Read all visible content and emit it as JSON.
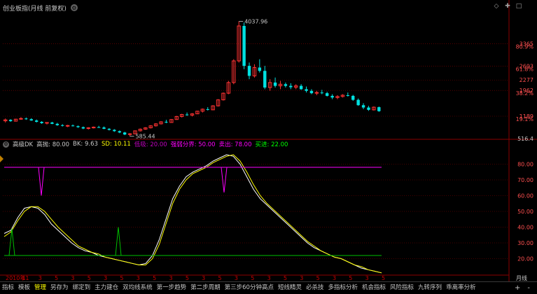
{
  "header": {
    "title": "创业板指(月线 前复权)",
    "controls": [
      "◇",
      "✚",
      "□"
    ]
  },
  "price_chart": {
    "axis_labels": [
      {
        "text": "3365",
        "value": 3365,
        "color": "#ff5050"
      },
      {
        "text": "80.9%",
        "value": 3280,
        "color": "#ff5050"
      },
      {
        "text": "2693",
        "value": 2693,
        "color": "#ff5050"
      },
      {
        "text": "61.8%",
        "value": 2610,
        "color": "#ff5050"
      },
      {
        "text": "2277",
        "value": 2277,
        "color": "#ff5050"
      },
      {
        "text": "1962",
        "value": 1962,
        "color": "#ff5050"
      },
      {
        "text": "38.2%",
        "value": 1880,
        "color": "#ff5050"
      },
      {
        "text": "1189",
        "value": 1189,
        "color": "#ff5050"
      },
      {
        "text": "19.1%",
        "value": 1110,
        "color": "#ff5050"
      },
      {
        "text": "516.4",
        "value": 516.4,
        "color": "#c8c8c8"
      }
    ],
    "high_label": "4037.96",
    "low_label": "585.44",
    "high_value": 4037.96,
    "low_value": 585.44,
    "colors": {
      "up": "#ff3232",
      "down": "#00e0e0",
      "grid": "#8b0000"
    }
  },
  "indicator": {
    "name": "高级DK",
    "params": [
      {
        "label": "高抛: 80.00",
        "color": "#c8c8c8"
      },
      {
        "label": "BK: 9.63",
        "color": "#c8c8c8"
      },
      {
        "label": "SD: 10.11",
        "color": "#ffff00"
      },
      {
        "label": "低吸: 20.00",
        "color": "#c000c0"
      },
      {
        "label": "强弱分界: 50.00",
        "color": "#ff00ff"
      },
      {
        "label": "卖出: 78.00",
        "color": "#ff00ff"
      },
      {
        "label": "买进: 22.00",
        "color": "#00ff00"
      }
    ],
    "axis_labels": [
      "80.00",
      "70.00",
      "60.00",
      "50.00",
      "40.00",
      "30.00",
      "20.00"
    ],
    "axis_values": [
      80,
      70,
      60,
      50,
      40,
      30,
      20
    ]
  },
  "time_axis": {
    "labels": [
      "2010年",
      "11",
      "3",
      "5",
      "3",
      "5",
      "3",
      "5",
      "3",
      "5",
      "3",
      "5",
      "3",
      "5",
      "3",
      "5",
      "3",
      "5",
      "3",
      "5",
      "3",
      "5",
      "3",
      "5"
    ],
    "period_label": "月线"
  },
  "chart_data": [
    {
      "type": "candlestick",
      "title": "创业板指(月线 前复权)",
      "series": [
        {
          "name": "monthly",
          "ohlc": [
            [
              1050,
              1120,
              1000,
              1080
            ],
            [
              1080,
              1100,
              1020,
              1040
            ],
            [
              1040,
              1110,
              1030,
              1100
            ],
            [
              1100,
              1160,
              1080,
              1120
            ],
            [
              1120,
              1150,
              1080,
              1100
            ],
            [
              1100,
              1130,
              1050,
              1060
            ],
            [
              1060,
              1090,
              1000,
              1020
            ],
            [
              1020,
              1040,
              960,
              980
            ],
            [
              980,
              1010,
              940,
              1000
            ],
            [
              1000,
              1020,
              950,
              960
            ],
            [
              960,
              990,
              900,
              920
            ],
            [
              920,
              950,
              880,
              900
            ],
            [
              900,
              930,
              860,
              910
            ],
            [
              910,
              940,
              880,
              890
            ],
            [
              890,
              910,
              840,
              860
            ],
            [
              860,
              880,
              800,
              820
            ],
            [
              820,
              860,
              790,
              840
            ],
            [
              840,
              880,
              820,
              860
            ],
            [
              860,
              900,
              840,
              850
            ],
            [
              850,
              880,
              800,
              810
            ],
            [
              810,
              830,
              760,
              780
            ],
            [
              780,
              800,
              720,
              740
            ],
            [
              740,
              760,
              680,
              700
            ],
            [
              700,
              720,
              620,
              640
            ],
            [
              640,
              680,
              585,
              660
            ],
            [
              660,
              760,
              650,
              750
            ],
            [
              750,
              820,
              730,
              800
            ],
            [
              800,
              860,
              780,
              840
            ],
            [
              840,
              920,
              820,
              900
            ],
            [
              900,
              980,
              880,
              960
            ],
            [
              960,
              1040,
              940,
              1020
            ],
            [
              1020,
              1080,
              980,
              1000
            ],
            [
              1000,
              1100,
              990,
              1090
            ],
            [
              1090,
              1200,
              1080,
              1180
            ],
            [
              1180,
              1260,
              1150,
              1240
            ],
            [
              1240,
              1300,
              1200,
              1220
            ],
            [
              1220,
              1280,
              1180,
              1260
            ],
            [
              1260,
              1350,
              1250,
              1340
            ],
            [
              1340,
              1420,
              1300,
              1400
            ],
            [
              1400,
              1460,
              1360,
              1380
            ],
            [
              1380,
              1520,
              1370,
              1500
            ],
            [
              1500,
              1700,
              1480,
              1680
            ],
            [
              1680,
              1900,
              1660,
              1880
            ],
            [
              1880,
              2250,
              1850,
              2200
            ],
            [
              2200,
              2900,
              2150,
              2850
            ],
            [
              2850,
              4037.96,
              2800,
              3900
            ],
            [
              3900,
              4000,
              2600,
              2700
            ],
            [
              2700,
              2800,
              2300,
              2400
            ],
            [
              2400,
              2750,
              2350,
              2650
            ],
            [
              2650,
              2900,
              2500,
              2550
            ],
            [
              2550,
              2700,
              2000,
              2050
            ],
            [
              2050,
              2300,
              1950,
              2200
            ],
            [
              2200,
              2350,
              2050,
              2100
            ],
            [
              2100,
              2250,
              2000,
              2150
            ],
            [
              2150,
              2200,
              2050,
              2100
            ],
            [
              2100,
              2180,
              2000,
              2060
            ],
            [
              2060,
              2150,
              2000,
              2100
            ],
            [
              2100,
              2150,
              1980,
              2000
            ],
            [
              2000,
              2080,
              1900,
              1950
            ],
            [
              1950,
              2000,
              1850,
              1880
            ],
            [
              1880,
              1950,
              1820,
              1900
            ],
            [
              1900,
              1980,
              1850,
              1880
            ],
            [
              1880,
              1920,
              1780,
              1800
            ],
            [
              1800,
              1850,
              1700,
              1750
            ],
            [
              1750,
              1820,
              1700,
              1780
            ],
            [
              1780,
              1850,
              1750,
              1820
            ],
            [
              1820,
              1900,
              1780,
              1800
            ],
            [
              1800,
              1830,
              1650,
              1680
            ],
            [
              1680,
              1720,
              1500,
              1520
            ],
            [
              1520,
              1580,
              1400,
              1450
            ],
            [
              1450,
              1500,
              1350,
              1380
            ],
            [
              1380,
              1480,
              1360,
              1460
            ],
            [
              1460,
              1480,
              1320,
              1340
            ]
          ]
        }
      ],
      "ylim": [
        516.4,
        4300
      ]
    },
    {
      "type": "line",
      "title": "高级DK",
      "series": [
        {
          "name": "K",
          "color": "#ffffff",
          "values": [
            36,
            38,
            46,
            52,
            53,
            52,
            48,
            42,
            38,
            34,
            30,
            27,
            25,
            24,
            22,
            21,
            20,
            19,
            18,
            17,
            16,
            17,
            22,
            32,
            45,
            58,
            66,
            72,
            75,
            77,
            79,
            82,
            84,
            86,
            85,
            80,
            72,
            64,
            58,
            54,
            50,
            46,
            42,
            38,
            34,
            30,
            27,
            25,
            23,
            21,
            20,
            18,
            16,
            14,
            13,
            12,
            11
          ]
        },
        {
          "name": "D",
          "color": "#ffff00",
          "values": [
            34,
            37,
            44,
            50,
            53,
            53,
            50,
            45,
            40,
            36,
            32,
            28,
            26,
            24,
            23,
            21,
            20,
            19,
            18,
            17,
            16,
            16,
            20,
            29,
            42,
            55,
            64,
            70,
            74,
            76,
            78,
            81,
            83,
            85,
            86,
            82,
            75,
            67,
            60,
            55,
            51,
            47,
            43,
            39,
            35,
            31,
            28,
            25,
            23,
            21,
            20,
            18,
            16,
            15,
            13,
            12,
            11
          ]
        },
        {
          "name": "SELL",
          "color": "#ff00ff",
          "values": [
            78,
            78,
            78,
            78,
            78,
            78,
            78,
            78,
            78,
            78,
            78,
            78,
            78,
            78,
            78,
            78,
            78,
            78,
            78,
            78,
            78,
            78,
            78,
            78,
            78,
            78,
            78,
            78,
            78,
            78,
            78,
            78,
            78,
            78,
            78,
            78,
            78,
            78,
            78,
            78,
            78,
            78,
            78,
            78,
            78,
            78,
            78,
            78,
            78,
            78,
            78,
            78,
            78,
            78,
            78,
            78,
            78
          ]
        },
        {
          "name": "BUY",
          "color": "#00c000",
          "values": [
            22,
            22,
            22,
            22,
            22,
            22,
            22,
            22,
            22,
            22,
            22,
            22,
            22,
            22,
            22,
            22,
            22,
            22,
            22,
            22,
            22,
            22,
            22,
            22,
            22,
            22,
            22,
            22,
            22,
            22,
            22,
            22,
            22,
            22,
            22,
            22,
            22,
            22,
            22,
            22,
            22,
            22,
            22,
            22,
            22,
            22,
            22,
            22,
            22,
            22,
            22,
            22,
            22,
            22,
            22,
            22,
            22
          ]
        }
      ],
      "ylim": [
        10,
        90
      ]
    }
  ],
  "tabs": [
    {
      "label": "指标",
      "active": false
    },
    {
      "label": "模板",
      "active": false
    },
    {
      "label": "管理",
      "active": true
    },
    {
      "label": "另存为",
      "active": false
    },
    {
      "label": "绑定到",
      "active": false
    },
    {
      "label": "主力建仓",
      "active": false
    },
    {
      "label": "双均线系统",
      "active": false
    },
    {
      "label": "第一步趋势",
      "active": false
    },
    {
      "label": "第二步周期",
      "active": false
    },
    {
      "label": "第三步60分钟高点",
      "active": false
    },
    {
      "label": "短线精灵",
      "active": false
    },
    {
      "label": "必杀技",
      "active": false
    },
    {
      "label": "多指标分析",
      "active": false
    },
    {
      "label": "机会指标",
      "active": false
    },
    {
      "label": "风险指标",
      "active": false
    },
    {
      "label": "九转序列",
      "active": false
    },
    {
      "label": "乖离率分析",
      "active": false
    }
  ],
  "tabbar_controls": [
    "+",
    "-"
  ]
}
